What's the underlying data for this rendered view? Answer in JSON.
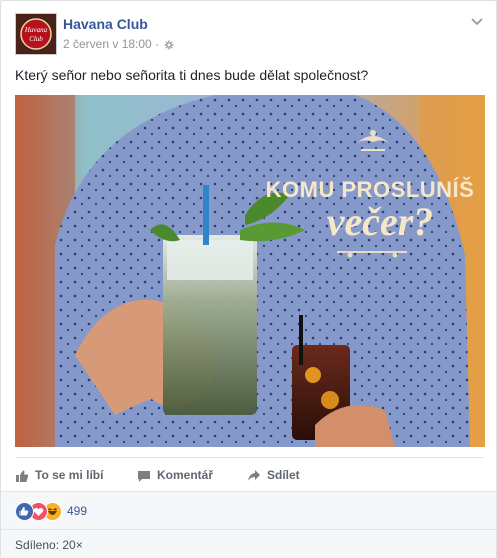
{
  "post": {
    "page_name": "Havana Club",
    "timestamp": "2 červen v 18:00",
    "separator": "·",
    "text": "Který señor nebo señorita ti dnes bude dělat společnost?",
    "avatar_text": [
      "Havana",
      "Club"
    ]
  },
  "photo": {
    "headline": "KOMU PROSLUNÍŠ",
    "headline_big": "večer?"
  },
  "actions": {
    "like": "To se mi líbí",
    "comment": "Komentář",
    "share": "Sdílet"
  },
  "reactions": {
    "icons": [
      "like-icon",
      "love-icon",
      "haha-icon"
    ],
    "count": "499"
  },
  "shares": {
    "label": "Sdíleno: 20×"
  },
  "colors": {
    "link": "#365899",
    "like": "#4267b2",
    "love": "#ed5167",
    "haha": "#f7b125",
    "background": "#e9ebee"
  }
}
